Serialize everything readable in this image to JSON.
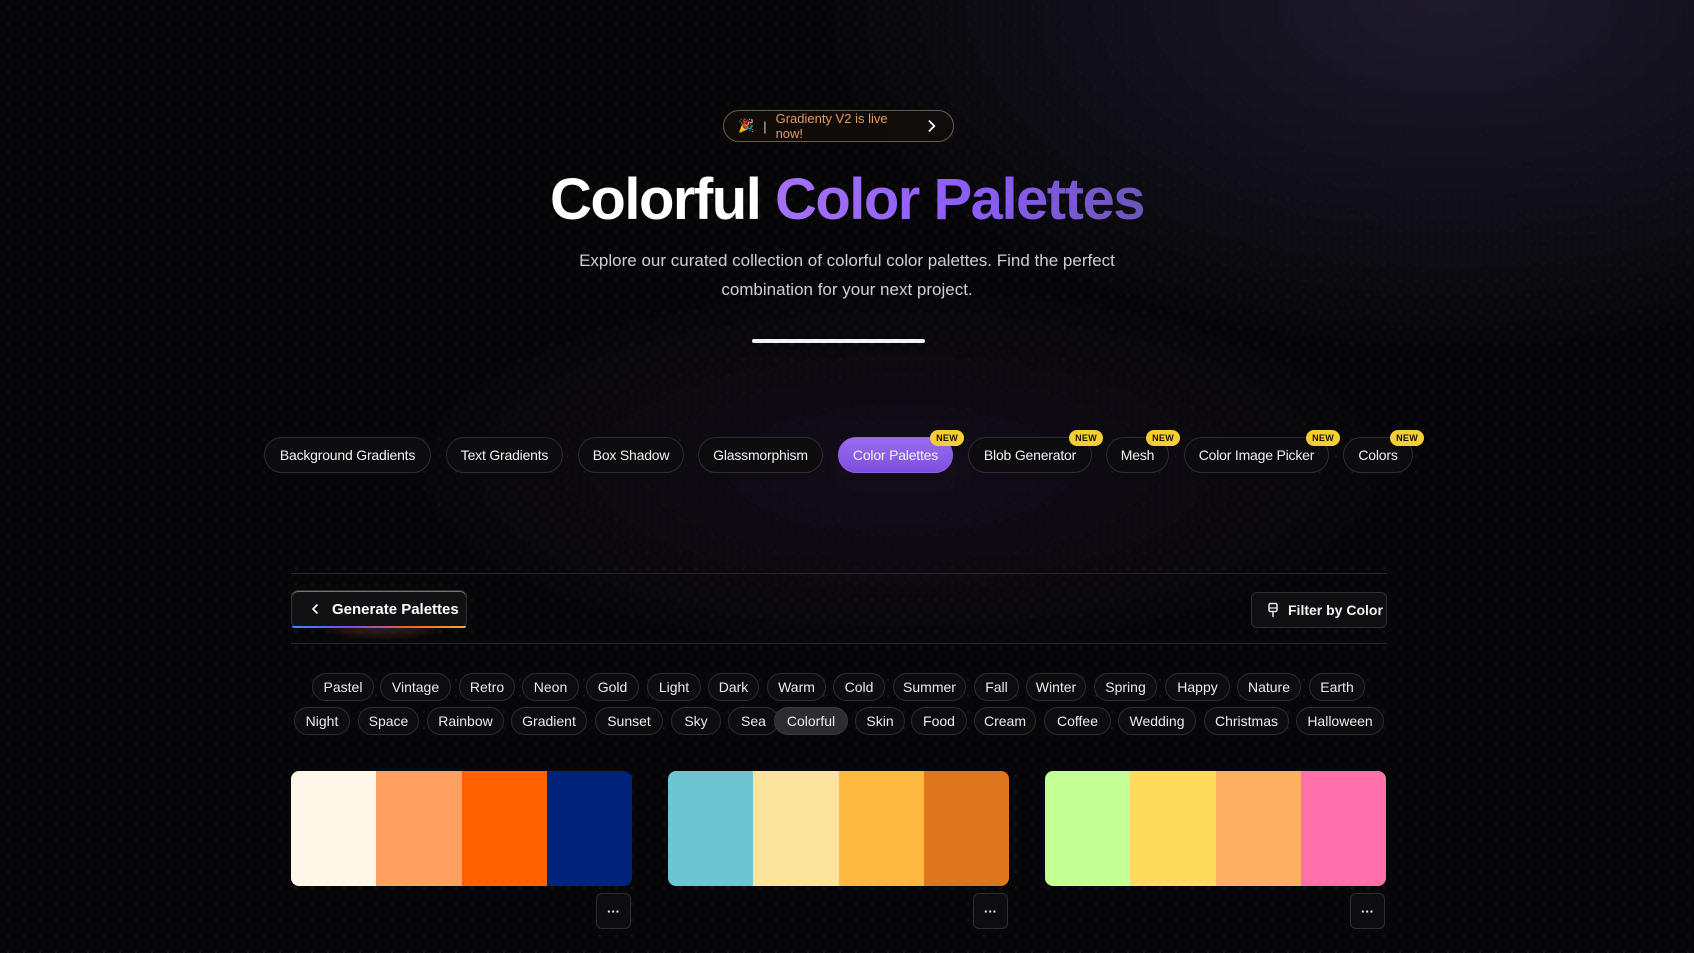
{
  "announcement": {
    "emoji": "🎉",
    "separator": "|",
    "text": "Gradienty V2 is live now!"
  },
  "hero": {
    "title_plain": "Colorful",
    "title_accent": "Color Palettes",
    "subtitle": "Explore our curated collection of colorful color palettes. Find the perfect combination for your next project."
  },
  "nav": {
    "items": [
      {
        "label": "Background Gradients",
        "badge": ""
      },
      {
        "label": "Text Gradients",
        "badge": ""
      },
      {
        "label": "Box Shadow",
        "badge": ""
      },
      {
        "label": "Glassmorphism",
        "badge": ""
      },
      {
        "label": "Color Palettes",
        "badge": "NEW",
        "active": true
      },
      {
        "label": "Blob Generator",
        "badge": "NEW"
      },
      {
        "label": "Mesh",
        "badge": "NEW"
      },
      {
        "label": "Color Image Picker",
        "badge": "NEW"
      },
      {
        "label": "Colors",
        "badge": "NEW"
      }
    ]
  },
  "toolbar": {
    "generate_label": "Generate Palettes",
    "filter_label": "Filter by Color"
  },
  "tags": {
    "row1": [
      "Pastel",
      "Vintage",
      "Retro",
      "Neon",
      "Gold",
      "Light",
      "Dark",
      "Warm",
      "Cold",
      "Summer",
      "Fall",
      "Winter",
      "Spring",
      "Happy",
      "Nature",
      "Earth"
    ],
    "row2": [
      "Night",
      "Space",
      "Rainbow",
      "Gradient",
      "Sunset",
      "Sky",
      "Sea",
      "Colorful",
      "Skin",
      "Food",
      "Cream",
      "Coffee",
      "Wedding",
      "Christmas",
      "Halloween"
    ],
    "active": "Colorful"
  },
  "palettes": [
    {
      "colors": [
        "#FFF8E8",
        "#FFA062",
        "#FF6000",
        "#002379"
      ]
    },
    {
      "colors": [
        "#6DC5D1",
        "#FDE49E",
        "#FEB941",
        "#DD761C"
      ]
    },
    {
      "colors": [
        "#C3FF93",
        "#FFDB5C",
        "#FFAF61",
        "#FF70AB"
      ]
    }
  ],
  "more_label": "···",
  "accent_colors": {
    "purple": "#8B5CF6",
    "badge": "#F4CF34",
    "announce_text": "#E79A5A"
  }
}
